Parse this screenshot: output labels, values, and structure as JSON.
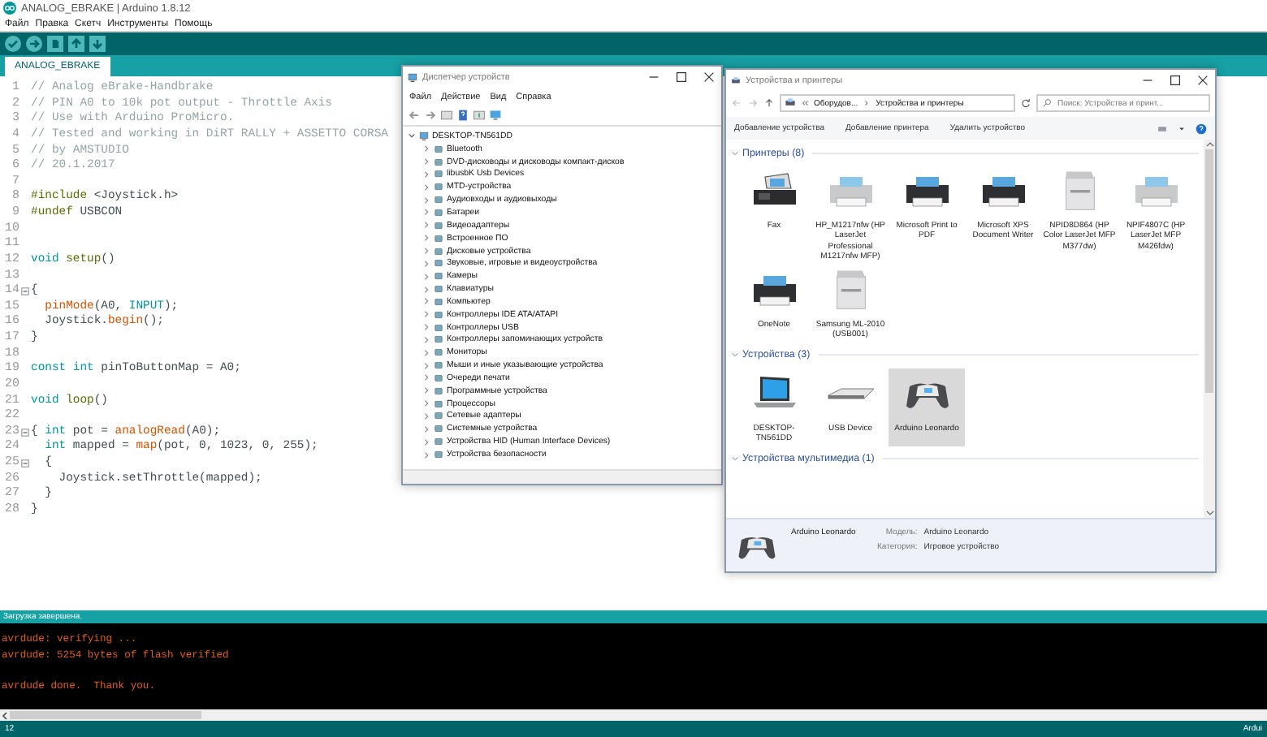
{
  "arduino": {
    "title": "ANALOG_EBRAKE | Arduino 1.8.12",
    "menu": [
      "Файл",
      "Правка",
      "Скетч",
      "Инструменты",
      "Помощь"
    ],
    "tab": {
      "label": "ANALOG_EBRAKE",
      "selected": true
    },
    "code": [
      {
        "n": "1",
        "segments": [
          {
            "text": "// Analog eBrake-Handbrake",
            "kind": "comment"
          }
        ]
      },
      {
        "n": "2",
        "segments": [
          {
            "text": "// PIN A0 to 10k pot output - Throttle Axis",
            "kind": "comment"
          }
        ]
      },
      {
        "n": "3",
        "segments": [
          {
            "text": "// Use with Arduino ProMicro.",
            "kind": "comment"
          }
        ]
      },
      {
        "n": "4",
        "segments": [
          {
            "text": "// Tested and working in DiRT RALLY + ASSETTO CORSA",
            "kind": "comment"
          }
        ]
      },
      {
        "n": "5",
        "segments": [
          {
            "text": "// by AMSTUDIO",
            "kind": "comment"
          }
        ]
      },
      {
        "n": "6",
        "segments": [
          {
            "text": "// 20.1.2017",
            "kind": "comment"
          }
        ]
      },
      {
        "n": "7"
      },
      {
        "n": "8",
        "segments": [
          {
            "text": "#include",
            "kind": "directive"
          },
          {
            "text": " <Joystick.h>",
            "kind": "plain"
          }
        ]
      },
      {
        "n": "9",
        "segments": [
          {
            "text": "#undef",
            "kind": "directive"
          },
          {
            "text": " USBCON",
            "kind": "plain"
          }
        ]
      },
      {
        "n": "10"
      },
      {
        "n": "11"
      },
      {
        "n": "12",
        "segments": [
          {
            "text": "void ",
            "kind": "keyword"
          },
          {
            "text": "setup",
            "kind": "directive"
          },
          {
            "text": "()",
            "kind": "plain"
          }
        ]
      },
      {
        "n": "13"
      },
      {
        "n": "14",
        "fold": true,
        "segments": [
          {
            "text": "{",
            "kind": "plain"
          }
        ]
      },
      {
        "n": "15",
        "segments": [
          {
            "text": "  pinMode",
            "kind": "function"
          },
          {
            "text": "(A0, ",
            "kind": "plain"
          },
          {
            "text": "INPUT",
            "kind": "keyword"
          },
          {
            "text": ");",
            "kind": "plain"
          }
        ]
      },
      {
        "n": "16",
        "segments": [
          {
            "text": "  Joystick.",
            "kind": "plain"
          },
          {
            "text": "begin",
            "kind": "function"
          },
          {
            "text": "();",
            "kind": "plain"
          }
        ]
      },
      {
        "n": "17",
        "segments": [
          {
            "text": "}",
            "kind": "plain"
          }
        ]
      },
      {
        "n": "18"
      },
      {
        "n": "19",
        "segments": [
          {
            "text": "const int",
            "kind": "keyword"
          },
          {
            "text": " pinToButtonMap = A0;",
            "kind": "plain"
          }
        ]
      },
      {
        "n": "20"
      },
      {
        "n": "21",
        "segments": [
          {
            "text": "void ",
            "kind": "keyword"
          },
          {
            "text": "loop",
            "kind": "directive"
          },
          {
            "text": "()",
            "kind": "plain"
          }
        ]
      },
      {
        "n": "22"
      },
      {
        "n": "23",
        "fold": true,
        "segments": [
          {
            "text": "{ ",
            "kind": "plain"
          },
          {
            "text": "int",
            "kind": "keyword"
          },
          {
            "text": " pot = ",
            "kind": "plain"
          },
          {
            "text": "analogRead",
            "kind": "function"
          },
          {
            "text": "(A0);",
            "kind": "plain"
          }
        ]
      },
      {
        "n": "24",
        "segments": [
          {
            "text": "  int",
            "kind": "keyword"
          },
          {
            "text": " mapped = ",
            "kind": "plain"
          },
          {
            "text": "map",
            "kind": "function"
          },
          {
            "text": "(pot, 0, 1023, 0, 255);",
            "kind": "plain"
          }
        ]
      },
      {
        "n": "25",
        "fold": true,
        "segments": [
          {
            "text": "  {",
            "kind": "plain"
          }
        ]
      },
      {
        "n": "26",
        "segments": [
          {
            "text": "    Joystick.setThrottle(mapped);",
            "kind": "plain"
          }
        ]
      },
      {
        "n": "27",
        "segments": [
          {
            "text": "  }",
            "kind": "plain"
          }
        ]
      },
      {
        "n": "28",
        "segments": [
          {
            "text": "}",
            "kind": "plain"
          }
        ]
      }
    ],
    "status_message": "Загрузка завершена.",
    "console": [
      {
        "text": "avrdude: verifying ...",
        "blank_before": false
      },
      {
        "text": "avrdude: 5254 bytes of flash verified",
        "blank_before": false
      },
      {
        "text": "avrdude done.  Thank you.",
        "blank_before": true
      }
    ],
    "footer": {
      "line": "12",
      "board": "Ardui"
    }
  },
  "device_manager": {
    "title": "Диспетчер устройств",
    "menu": [
      "Файл",
      "Действие",
      "Вид",
      "Справка"
    ],
    "tree": {
      "label": "DESKTOP-TN561DD",
      "expanded": true,
      "children": [
        {
          "label": "Bluetooth",
          "expanded": false
        },
        {
          "label": "DVD-дисководы и дисководы компакт-дисков",
          "expanded": false
        },
        {
          "label": "libusbK Usb Devices",
          "expanded": false
        },
        {
          "label": "MTD-устройства",
          "expanded": false
        },
        {
          "label": "Аудиовходы и аудиовыходы",
          "expanded": false
        },
        {
          "label": "Батареи",
          "expanded": false
        },
        {
          "label": "Видеоадаптеры",
          "expanded": false
        },
        {
          "label": "Встроенное ПО",
          "expanded": false
        },
        {
          "label": "Дисковые устройства",
          "expanded": false
        },
        {
          "label": "Звуковые, игровые и видеоустройства",
          "expanded": false
        },
        {
          "label": "Камеры",
          "expanded": false
        },
        {
          "label": "Клавиатуры",
          "expanded": false
        },
        {
          "label": "Компьютер",
          "expanded": false
        },
        {
          "label": "Контроллеры IDE ATA/ATAPI",
          "expanded": false
        },
        {
          "label": "Контроллеры USB",
          "expanded": false
        },
        {
          "label": "Контроллеры запоминающих устройств",
          "expanded": false
        },
        {
          "label": "Мониторы",
          "expanded": false
        },
        {
          "label": "Мыши и иные указывающие устройства",
          "expanded": false
        },
        {
          "label": "Очереди печати",
          "expanded": false
        },
        {
          "label": "Программные устройства",
          "expanded": false
        },
        {
          "label": "Процессоры",
          "expanded": false
        },
        {
          "label": "Сетевые адаптеры",
          "expanded": false
        },
        {
          "label": "Системные устройства",
          "expanded": false
        },
        {
          "label": "Устройства HID (Human Interface Devices)",
          "expanded": false
        },
        {
          "label": "Устройства безопасности",
          "expanded": false
        }
      ]
    }
  },
  "devices_printers": {
    "title": "Устройства и принтеры",
    "breadcrumb": [
      "Оборудов...",
      "Устройства и принтеры"
    ],
    "search": {
      "placeholder": "Поиск: Устройства и принт..."
    },
    "commands": [
      "Добавление устройства",
      "Добавление принтера",
      "Удалить устройство"
    ],
    "groups": [
      {
        "title": "Принтеры (8)",
        "expanded": true,
        "items": [
          {
            "label": "Fax",
            "kind": "fax",
            "selected": false
          },
          {
            "label": "HP_M1217nfw (HP LaserJet Professional M1217nfw MFP)",
            "kind": "lightprinter",
            "selected": false
          },
          {
            "label": "Microsoft Print to PDF",
            "kind": "printer",
            "selected": false
          },
          {
            "label": "Microsoft XPS Document Writer",
            "kind": "printer",
            "selected": false
          },
          {
            "label": "NPID8D864 (HP Color LaserJet MFP M377dw)",
            "kind": "mfp",
            "selected": false
          },
          {
            "label": "NPIF4807C (HP LaserJet MFP M426fdw)",
            "kind": "lightprinter",
            "selected": false
          },
          {
            "label": "OneNote",
            "kind": "printer",
            "selected": false
          },
          {
            "label": "Samsung ML-2010 (USB001)",
            "kind": "mfp",
            "selected": false
          }
        ]
      },
      {
        "title": "Устройства (3)",
        "expanded": true,
        "items": [
          {
            "label": "DESKTOP-TN561DD",
            "kind": "laptop",
            "selected": false
          },
          {
            "label": "USB Device",
            "kind": "keyboard",
            "selected": false
          },
          {
            "label": "Arduino Leonardo",
            "kind": "gamepad",
            "selected": true
          }
        ]
      },
      {
        "title": "Устройства мультимедиа (1)",
        "expanded": true
      }
    ],
    "details": {
      "name": "Arduino Leonardo",
      "fields": [
        {
          "label": "Модель:",
          "value": "Arduino Leonardo"
        },
        {
          "label": "Категория:",
          "value": "Игровое устройство"
        }
      ]
    }
  }
}
